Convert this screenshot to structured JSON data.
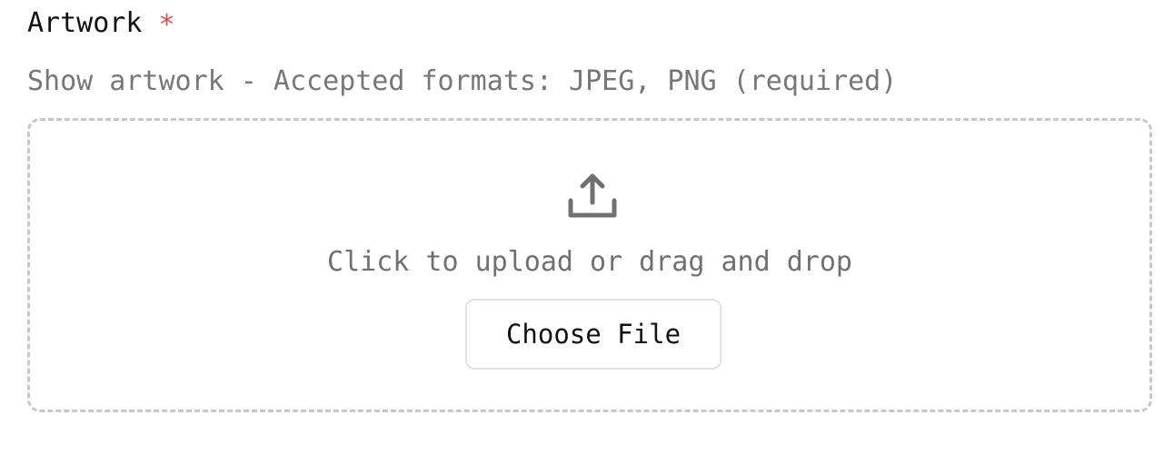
{
  "field": {
    "label": "Artwork",
    "required_mark": "*",
    "help_text": "Show artwork - Accepted formats: JPEG, PNG (required)"
  },
  "dropzone": {
    "icon": "upload-icon",
    "instruction": "Click to upload or drag and drop",
    "button_label": "Choose File"
  },
  "colors": {
    "required": "#e5484d",
    "icon": "#707070",
    "border": "#c8c8c8"
  }
}
